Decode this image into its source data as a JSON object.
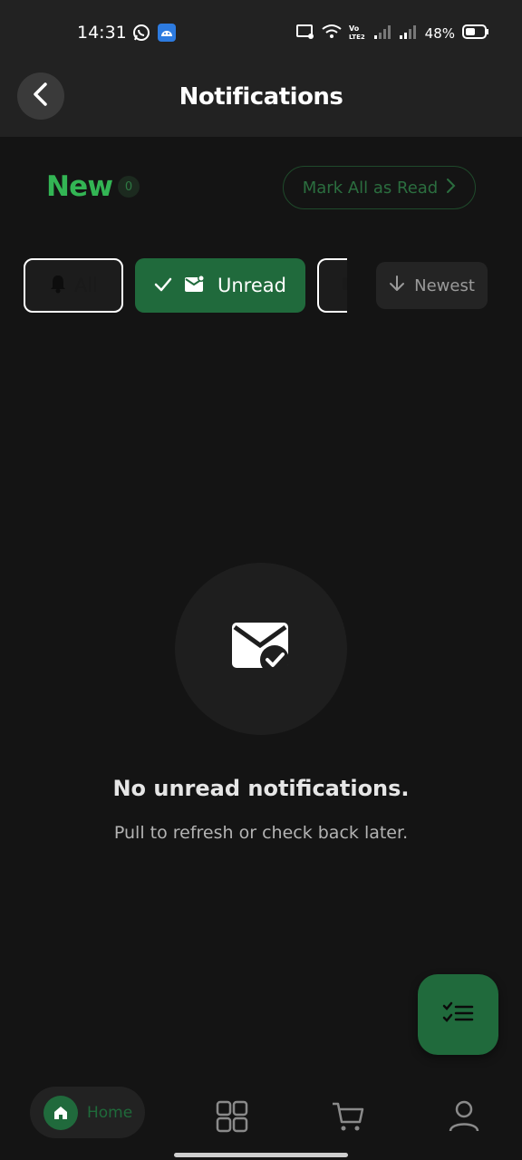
{
  "status_bar": {
    "time": "14:31",
    "battery": "48%",
    "icons": [
      "whatsapp-icon",
      "android-icon",
      "cast-icon",
      "wifi-icon",
      "volte-icon",
      "signal-icon",
      "signal-icon",
      "battery-icon"
    ]
  },
  "header": {
    "title": "Notifications",
    "back_icon": "chevron-left-icon"
  },
  "section": {
    "title": "New",
    "count": "0",
    "mark_all_label": "Mark All as Read"
  },
  "filters": {
    "all_label": "All",
    "unread_label": "Unread",
    "active": "Unread",
    "sort_label": "Newest"
  },
  "empty_state": {
    "title": "No unread notifications.",
    "subtitle": "Pull to refresh or check back later.",
    "icon": "mail-check-icon"
  },
  "fab": {
    "icon": "checklist-icon"
  },
  "bottom_nav": {
    "home_label": "Home",
    "items": [
      "home-icon",
      "grid-icon",
      "cart-icon",
      "profile-icon"
    ]
  },
  "colors": {
    "accent": "#206a3c",
    "accent_text": "#33b554",
    "background": "#141414",
    "header_bg": "#222222"
  }
}
